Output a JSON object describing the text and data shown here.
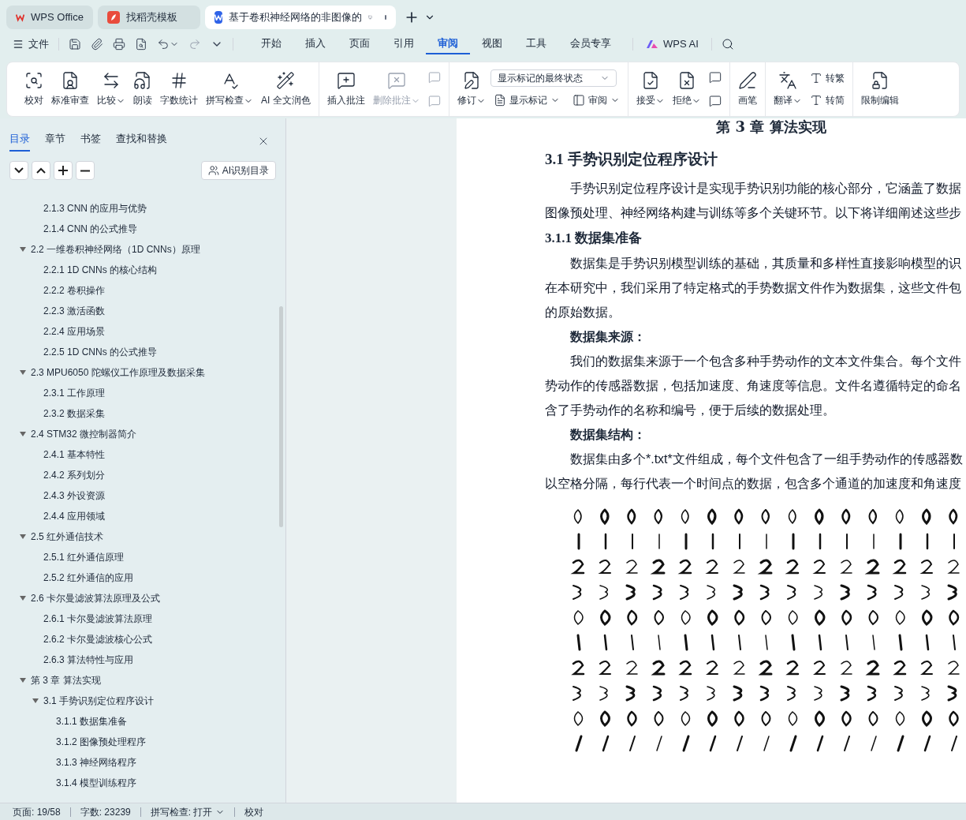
{
  "title_bar": {
    "tabs": [
      {
        "label": "WPS Office",
        "kind": "home",
        "selected": false
      },
      {
        "label": "找稻壳模板",
        "kind": "template",
        "selected": false
      },
      {
        "label": "基于卷积神经网络的非图像的",
        "kind": "document",
        "selected": true
      }
    ]
  },
  "menu_bar": {
    "file": "文件",
    "tabs": [
      {
        "label": "开始",
        "selected": false
      },
      {
        "label": "插入",
        "selected": false
      },
      {
        "label": "页面",
        "selected": false
      },
      {
        "label": "引用",
        "selected": false
      },
      {
        "label": "审阅",
        "selected": true
      },
      {
        "label": "视图",
        "selected": false
      },
      {
        "label": "工具",
        "selected": false
      },
      {
        "label": "会员专享",
        "selected": false
      }
    ],
    "ai": "WPS AI"
  },
  "ribbon": {
    "groups": [
      {
        "columns": [
          [
            {
              "kind": "large",
              "label": "校对",
              "menu": false,
              "disabled": false
            }
          ],
          [
            {
              "kind": "large",
              "label": "标准审查",
              "menu": false,
              "disabled": false
            }
          ],
          [
            {
              "kind": "large",
              "label": "比较",
              "menu": true,
              "disabled": false
            }
          ],
          [
            {
              "kind": "large",
              "label": "朗读",
              "menu": false,
              "disabled": false
            }
          ],
          [
            {
              "kind": "large",
              "label": "字数统计",
              "menu": false,
              "disabled": false
            }
          ],
          [
            {
              "kind": "large",
              "label": "拼写检查",
              "menu": true,
              "disabled": false
            }
          ],
          [
            {
              "kind": "large",
              "label": "AI 全文润色",
              "menu": false,
              "disabled": false
            }
          ]
        ]
      },
      {
        "columns": [
          [
            {
              "kind": "large",
              "label": "插入批注",
              "menu": false,
              "disabled": false
            }
          ],
          [
            {
              "kind": "large",
              "label": "删除批注",
              "menu": true,
              "disabled": true
            }
          ],
          [
            {
              "kind": "icon",
              "disabled": true
            },
            {
              "kind": "icon",
              "disabled": true
            }
          ]
        ]
      },
      {
        "columns": [
          [
            {
              "kind": "large",
              "label": "修订",
              "menu": true,
              "disabled": false
            }
          ],
          [
            {
              "kind": "select",
              "value": "显示标记的最终状态",
              "disabled": false
            },
            {
              "kind": "small",
              "label": "显示标记",
              "menu": true,
              "disabled": false
            },
            {
              "kind": "small",
              "label": "审阅",
              "menu": true,
              "disabled": false
            }
          ]
        ]
      },
      {
        "columns": [
          [
            {
              "kind": "large",
              "label": "接受",
              "menu": true,
              "disabled": false
            }
          ],
          [
            {
              "kind": "large",
              "label": "拒绝",
              "menu": true,
              "disabled": false
            }
          ],
          [
            {
              "kind": "icon",
              "disabled": false
            },
            {
              "kind": "icon",
              "disabled": false
            }
          ]
        ]
      },
      {
        "columns": [
          [
            {
              "kind": "large",
              "label": "画笔",
              "menu": false,
              "disabled": false
            }
          ]
        ]
      },
      {
        "columns": [
          [
            {
              "kind": "large",
              "label": "翻译",
              "menu": true,
              "disabled": false
            }
          ],
          [
            {
              "kind": "small",
              "label": "转繁",
              "menu": false,
              "disabled": false
            },
            {
              "kind": "small",
              "label": "转简",
              "menu": false,
              "disabled": false
            }
          ]
        ]
      },
      {
        "columns": [
          [
            {
              "kind": "large",
              "label": "限制编辑",
              "menu": false,
              "disabled": false
            }
          ]
        ]
      }
    ]
  },
  "sidebar": {
    "tabs": [
      {
        "label": "目录",
        "selected": true
      },
      {
        "label": "章节",
        "selected": false
      },
      {
        "label": "书签",
        "selected": false
      },
      {
        "label": "查找和替换",
        "selected": false
      }
    ],
    "ai_button": "AI识别目录",
    "toc": [
      {
        "children": [
          {
            "children": [
              {
                "label": "2.1.3 CNN 的应用与优势"
              },
              {
                "label": "2.1.4 CNN 的公式推导"
              }
            ]
          },
          {
            "label": "2.2  一维卷积神经网络（1D CNNs）原理",
            "expanded": true,
            "children": [
              {
                "label": "2.2.1 1D CNNs 的核心结构"
              },
              {
                "label": "2.2.2  卷积操作"
              },
              {
                "label": "2.2.3  激活函数"
              },
              {
                "label": "2.2.4  应用场景"
              },
              {
                "label": "2.2.5 1D CNNs 的公式推导"
              }
            ]
          },
          {
            "label": "2.3 MPU6050 陀螺仪工作原理及数据采集",
            "expanded": true,
            "children": [
              {
                "label": "2.3.1  工作原理"
              },
              {
                "label": "2.3.2  数据采集"
              }
            ]
          },
          {
            "label": "2.4 STM32 微控制器简介",
            "expanded": true,
            "children": [
              {
                "label": "2.4.1  基本特性"
              },
              {
                "label": "2.4.2  系列划分"
              },
              {
                "label": "2.4.3  外设资源"
              },
              {
                "label": "2.4.4  应用领域"
              }
            ]
          },
          {
            "label": "2.5  红外通信技术",
            "expanded": true,
            "children": [
              {
                "label": "2.5.1  红外通信原理"
              },
              {
                "label": "2.5.2  红外通信的应用"
              }
            ]
          },
          {
            "label": "2.6  卡尔曼滤波算法原理及公式",
            "expanded": true,
            "children": [
              {
                "label": "2.6.1 卡尔曼滤波算法原理"
              },
              {
                "label": "2.6.2 卡尔曼滤波核心公式"
              },
              {
                "label": "2.6.3 算法特性与应用"
              }
            ]
          }
        ]
      },
      {
        "label": "第 3 章  算法实现",
        "expanded": true,
        "children": [
          {
            "label": "3.1  手势识别定位程序设计",
            "expanded": true,
            "children": [
              {
                "label": "3.1.1  数据集准备"
              },
              {
                "label": "3.1.2  图像预处理程序"
              },
              {
                "label": "3.1.3  神经网络程序"
              },
              {
                "label": "3.1.4  模型训练程序"
              }
            ]
          }
        ]
      }
    ]
  },
  "document": {
    "blocks": [
      {
        "kind": "chapter",
        "text": "第 3 章  算法实现"
      },
      {
        "kind": "h2",
        "text": "3.1  手势识别定位程序设计"
      },
      {
        "kind": "para",
        "lines": [
          "手势识别定位程序设计是实现手势识别功能的核心部分，它涵盖了数据",
          "图像预处理、神经网络构建与训练等多个关键环节。以下将详细阐述这些步"
        ]
      },
      {
        "kind": "h3",
        "text": "3.1.1  数据集准备"
      },
      {
        "kind": "para",
        "lines": [
          "数据集是手势识别模型训练的基础，其质量和多样性直接影响模型的识",
          "在本研究中，我们采用了特定格式的手势数据文件作为数据集，这些文件包",
          "的原始数据。"
        ]
      },
      {
        "kind": "label",
        "text": "数据集来源："
      },
      {
        "kind": "para",
        "lines": [
          "我们的数据集来源于一个包含多种手势动作的文本文件集合。每个文件",
          "势动作的传感器数据，包括加速度、角速度等信息。文件名遵循特定的命名",
          "含了手势动作的名称和编号，便于后续的数据处理。"
        ]
      },
      {
        "kind": "label",
        "text": "数据集结构："
      },
      {
        "kind": "para",
        "lines": [
          "数据集由多个*.txt*文件组成，每个文件包含了一组手势动作的传感器数",
          "以空格分隔，每行代表一个时间点的数据，包含多个通道的加速度和角速度"
        ]
      },
      {
        "kind": "picture"
      }
    ]
  },
  "status_bar": {
    "page": "页面: 19/58",
    "words": "字数: 23239",
    "spell": "拼写检查: 打开",
    "proof": "校对"
  }
}
